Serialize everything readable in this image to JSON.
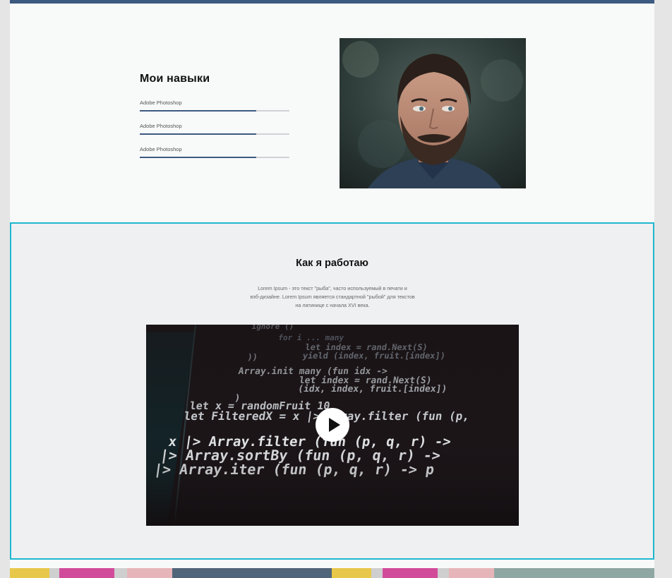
{
  "skills": {
    "title": "Мои навыки",
    "items": [
      {
        "label": "Adobe Photoshop",
        "level": 0.78
      },
      {
        "label": "Adobe Photoshop",
        "level": 0.78
      },
      {
        "label": "Adobe Photoshop",
        "level": 0.78
      }
    ]
  },
  "work": {
    "title": "Как я работаю",
    "lines": [
      "Lorem Ipsum - это текст \"рыба\", часто используемый в печати и",
      "вэб-дизайне. Lorem Ipsum является стандартной \"рыбой\" для текстов",
      "на латинице с начала XVI века."
    ]
  },
  "video_code": [
    {
      "text": "ignore ()",
      "color": "#9aa0a6"
    },
    {
      "text": "for i ... many",
      "color": "#7c8a9a"
    },
    {
      "text": "let index = rand.Next(S)",
      "color": "#9aa3ad"
    },
    {
      "text": "yield (index, fruit.[index])",
      "color": "#8f9aa6"
    },
    {
      "text": "))",
      "color": "#a7adb3"
    },
    {
      "text": "Array.init many (fun idx ->",
      "color": "#c7ccd1"
    },
    {
      "text": "let index = rand.Next(S)",
      "color": "#c7ccd1"
    },
    {
      "text": "(idx, index, fruit.[index])",
      "color": "#c7ccd1"
    },
    {
      "text": ")",
      "color": "#c7ccd1"
    },
    {
      "text": "let x = randomFruit 10",
      "color": "#d5d9dd"
    },
    {
      "text": "let FilteredX = x |> Array.filter (fun (p,",
      "color": "#d5d9dd"
    },
    {
      "text": "x |> Array.filter (fun (p, q, r) ->",
      "color": "#e6e8ea"
    },
    {
      "text": "|> Array.sortBy (fun (p, q, r) ->",
      "color": "#e6e8ea"
    },
    {
      "text": "|> Array.iter (fun (p, q, r) -> p",
      "color": "#e6e8ea"
    }
  ],
  "colors": {
    "accent": "#3d5a80",
    "highlight": "#1fb7cf"
  }
}
